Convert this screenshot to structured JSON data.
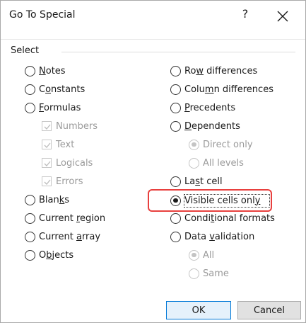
{
  "dialog": {
    "title": "Go To Special",
    "help": "?",
    "close_icon": "close-icon",
    "group_label": "Select"
  },
  "left_options": [
    {
      "pre": "",
      "u": "N",
      "post": "otes",
      "state": "unchecked",
      "enabled": true
    },
    {
      "pre": "C",
      "u": "o",
      "post": "nstants",
      "state": "unchecked",
      "enabled": true
    },
    {
      "pre": "",
      "u": "F",
      "post": "ormulas",
      "state": "unchecked",
      "enabled": true
    },
    {
      "pre": "Blan",
      "u": "k",
      "post": "s",
      "state": "unchecked",
      "enabled": true
    },
    {
      "pre": "Current ",
      "u": "r",
      "post": "egion",
      "state": "unchecked",
      "enabled": true
    },
    {
      "pre": "Current ",
      "u": "a",
      "post": "rray",
      "state": "unchecked",
      "enabled": true
    },
    {
      "pre": "O",
      "u": "b",
      "post": "jects",
      "state": "unchecked",
      "enabled": true
    }
  ],
  "formula_suboptions": [
    {
      "label": "Numbers",
      "checked": true,
      "enabled": false
    },
    {
      "label": "Text",
      "checked": true,
      "enabled": false
    },
    {
      "label": "Logicals",
      "checked": true,
      "enabled": false
    },
    {
      "label": "Errors",
      "checked": true,
      "enabled": false
    }
  ],
  "right_options": [
    {
      "pre": "Ro",
      "u": "w",
      "post": " differences",
      "state": "unchecked",
      "enabled": true
    },
    {
      "pre": "Colu",
      "u": "m",
      "post": "n differences",
      "state": "unchecked",
      "enabled": true
    },
    {
      "pre": "",
      "u": "P",
      "post": "recedents",
      "state": "unchecked",
      "enabled": true
    },
    {
      "pre": "",
      "u": "D",
      "post": "ependents",
      "state": "unchecked",
      "enabled": true
    },
    {
      "pre": "La",
      "u": "s",
      "post": "t cell",
      "state": "unchecked",
      "enabled": true
    },
    {
      "pre": "Visible cells onl",
      "u": "y",
      "post": "",
      "state": "checked",
      "enabled": true
    },
    {
      "pre": "Condi",
      "u": "t",
      "post": "ional formats",
      "state": "unchecked",
      "enabled": true
    },
    {
      "pre": "Data ",
      "u": "v",
      "post": "alidation",
      "state": "unchecked",
      "enabled": true
    }
  ],
  "dependents_suboptions": [
    {
      "label": "Direct only",
      "checked": true,
      "enabled": false
    },
    {
      "label": "All levels",
      "checked": false,
      "enabled": false
    }
  ],
  "validation_suboptions": [
    {
      "label": "All",
      "checked": true,
      "enabled": false
    },
    {
      "label": "Same",
      "checked": false,
      "enabled": false
    }
  ],
  "buttons": {
    "ok": "OK",
    "cancel": "Cancel"
  },
  "colors": {
    "highlight": "#e8403e",
    "default_button_border": "#0078d7"
  }
}
